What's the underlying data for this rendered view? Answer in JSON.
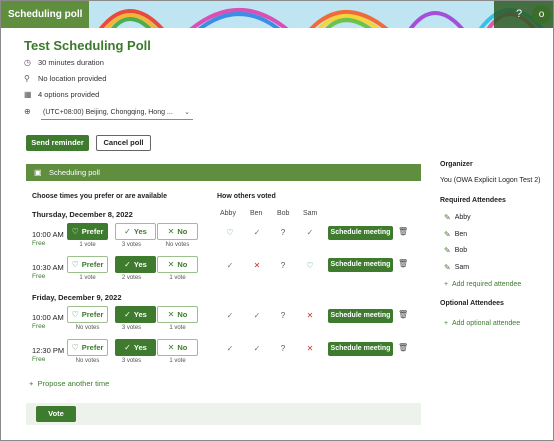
{
  "header": {
    "app_title": "Scheduling poll",
    "help_label": "?",
    "avatar_initial": "o"
  },
  "poll": {
    "title": "Test Scheduling Poll",
    "duration": "30 minutes duration",
    "location": "No location provided",
    "options": "4 options provided",
    "timezone": "(UTC+08:00) Beijing, Chongqing, Hong ..."
  },
  "actions": {
    "send_reminder": "Send reminder",
    "cancel_poll": "Cancel poll"
  },
  "section": {
    "title": "Scheduling poll",
    "choose_header": "Choose times you prefer or are available",
    "votes_header": "How others voted",
    "voters": [
      "Abby",
      "Ben",
      "Bob",
      "Sam"
    ]
  },
  "labels": {
    "prefer": "Prefer",
    "yes": "Yes",
    "no": "No",
    "free": "Free",
    "schedule": "Schedule meeting"
  },
  "days": [
    {
      "date": "Thursday, December 8, 2022",
      "slots": [
        {
          "time": "10:00 AM",
          "selected": "prefer",
          "counts": [
            "1 vote",
            "3 votes",
            "No votes"
          ],
          "marks": [
            "heart",
            "check",
            "question",
            "check"
          ]
        },
        {
          "time": "10:30 AM",
          "selected": "yes",
          "counts": [
            "1 vote",
            "2 votes",
            "1 vote"
          ],
          "marks": [
            "check",
            "cross",
            "question",
            "heart"
          ]
        }
      ]
    },
    {
      "date": "Friday, December 9, 2022",
      "slots": [
        {
          "time": "10:00 AM",
          "selected": "yes",
          "counts": [
            "No votes",
            "3 votes",
            "1 vote"
          ],
          "marks": [
            "check",
            "check",
            "question",
            "cross"
          ]
        },
        {
          "time": "12:30 PM",
          "selected": "yes",
          "counts": [
            "No votes",
            "3 votes",
            "1 vote"
          ],
          "marks": [
            "check",
            "check",
            "question",
            "cross"
          ]
        }
      ]
    }
  ],
  "propose": "Propose another time",
  "vote_button": "Vote",
  "sidebar": {
    "organizer_h": "Organizer",
    "organizer": "You (OWA Explicit Logon Test 2)",
    "required_h": "Required Attendees",
    "required": [
      "Abby",
      "Ben",
      "Bob",
      "Sam"
    ],
    "add_required": "Add required attendee",
    "optional_h": "Optional Attendees",
    "add_optional": "Add optional attendee"
  },
  "colors": {
    "brand_green": "#3e7b2e",
    "header_green": "#5f8e3f",
    "decline_red": "#c0392b"
  }
}
